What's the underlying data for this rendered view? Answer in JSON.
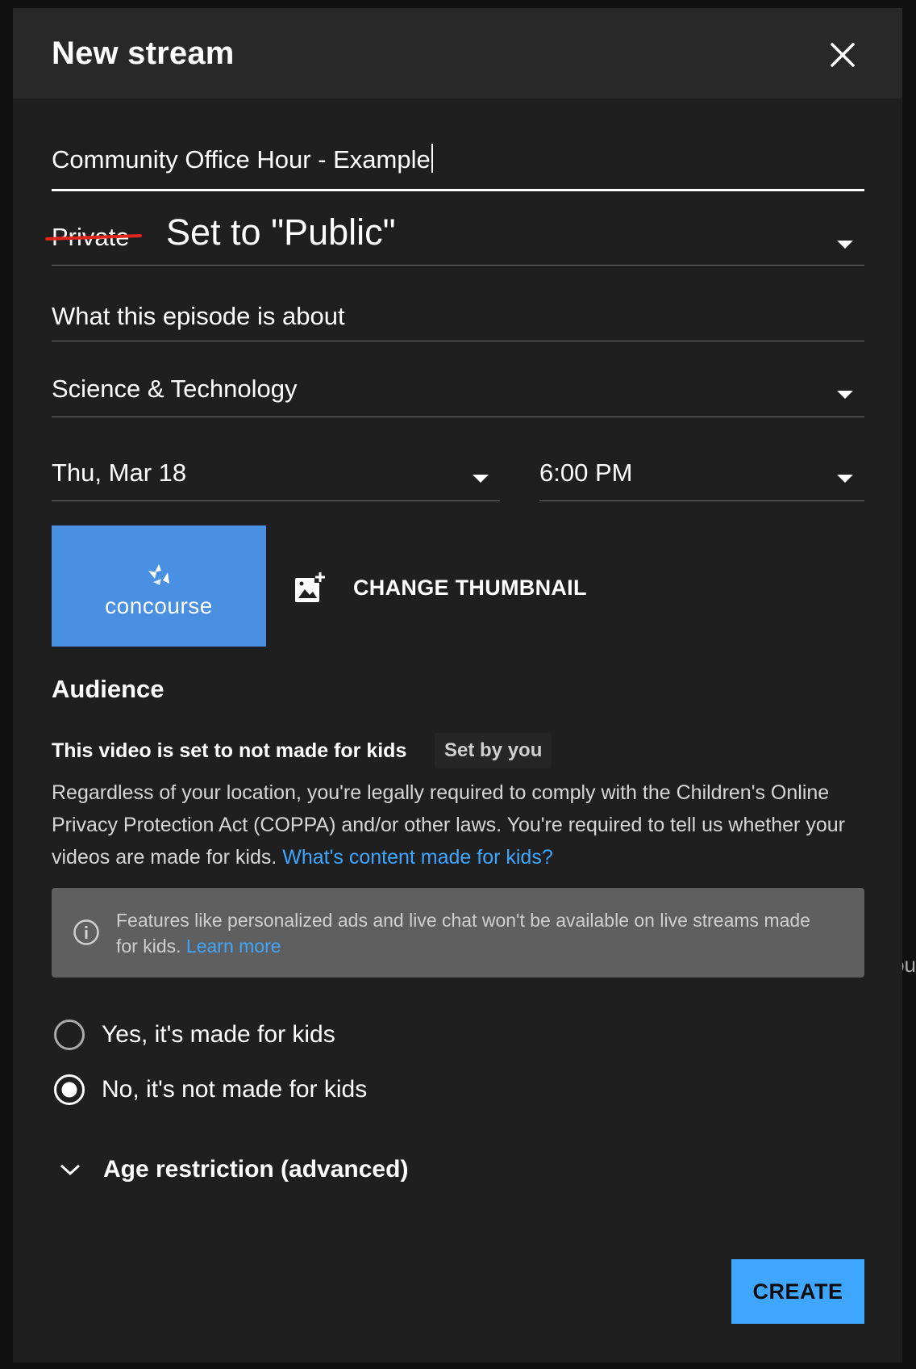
{
  "background": {
    "ghost_text": "ou"
  },
  "dialog": {
    "title": "New stream",
    "close_icon": "close-icon"
  },
  "form": {
    "title_value": "Community Office Hour - Example",
    "privacy_value": "Private",
    "privacy_annotation": "Set to \"Public\"",
    "description_value": "What this episode is about",
    "category_value": "Science & Technology",
    "date_value": "Thu, Mar 18",
    "time_value": "6:00 PM"
  },
  "thumbnail": {
    "logo_text": "concourse",
    "change_label": "CHANGE THUMBNAIL",
    "change_icon": "add-photo-icon",
    "thumb_color": "#4a90e2"
  },
  "audience": {
    "heading": "Audience",
    "status": "This video is set to not made for kids",
    "set_by": "Set by you",
    "coppa_text": "Regardless of your location, you're legally required to comply with the Children's Online Privacy Protection Act (COPPA) and/or other laws. You're required to tell us whether your videos are made for kids.",
    "coppa_link": "What's content made for kids?",
    "info_text": "Features like personalized ads and live chat won't be available on live streams made for kids.",
    "info_link": "Learn more",
    "option_yes": "Yes, it's made for kids",
    "option_no": "No, it's not made for kids",
    "selected": "no"
  },
  "advanced": {
    "age_restriction_label": "Age restriction (advanced)"
  },
  "actions": {
    "create_label": "CREATE",
    "accent_color": "#3ea6ff",
    "annotation_color": "#e0261c"
  }
}
